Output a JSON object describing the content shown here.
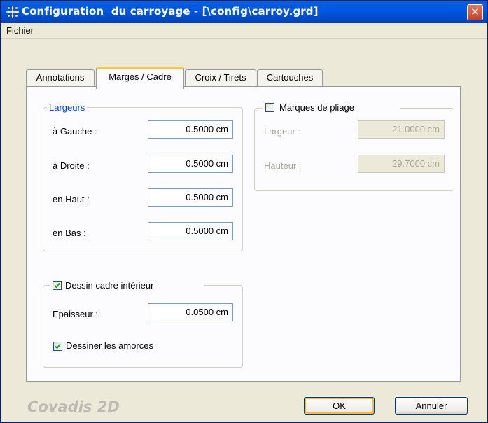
{
  "window": {
    "title": "Configuration  du carroyage - [\\config\\carroy.grd]",
    "close_glyph": "✕",
    "app_icon": "grid-icon"
  },
  "menu": {
    "items": [
      {
        "label": "Fichier"
      }
    ]
  },
  "tabs": [
    {
      "label": "Annotations",
      "active": false
    },
    {
      "label": "Marges / Cadre",
      "active": true
    },
    {
      "label": "Croix / Tirets",
      "active": false
    },
    {
      "label": "Cartouches",
      "active": false
    }
  ],
  "largeurs": {
    "legend": "Largeurs",
    "rows": [
      {
        "label": "à Gauche :",
        "value": "0.5000 cm"
      },
      {
        "label": "à Droite :",
        "value": "0.5000 cm"
      },
      {
        "label": "en Haut :",
        "value": "0.5000 cm"
      },
      {
        "label": "en Bas :",
        "value": "0.5000 cm"
      }
    ]
  },
  "pliage": {
    "label": "Marques de pliage",
    "checked": false,
    "largeur_label": "Largeur :",
    "largeur_value": "21.0000 cm",
    "hauteur_label": "Hauteur :",
    "hauteur_value": "29.7000 cm"
  },
  "cadre": {
    "label": "Dessin cadre intérieur",
    "checked": true,
    "epaisseur_label": "Epaisseur :",
    "epaisseur_value": "0.0500 cm",
    "amorces_label": "Dessiner les amorces",
    "amorces_checked": true
  },
  "footer": {
    "brand": "Covadis 2D",
    "ok_label": "OK",
    "cancel_label": "Annuler"
  },
  "colors": {
    "titlebar": "#0058e6",
    "legend_blue": "#0046d5",
    "active_tab_highlight": "#ffc83c",
    "check_green": "#21a121"
  }
}
